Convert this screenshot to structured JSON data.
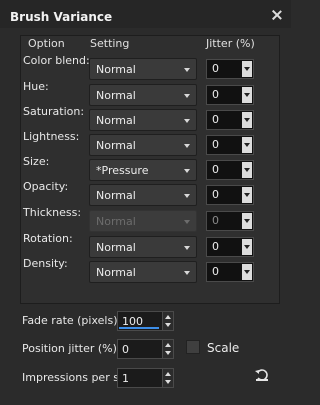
{
  "window": {
    "title": "Brush Variance"
  },
  "headers": {
    "option": "Option",
    "setting": "Setting",
    "jitter": "Jitter (%)"
  },
  "rows": [
    {
      "label": "Color blend:",
      "setting": "Normal",
      "jitter": "0"
    },
    {
      "label": "Hue:",
      "setting": "Normal",
      "jitter": "0"
    },
    {
      "label": "Saturation:",
      "setting": "Normal",
      "jitter": "0"
    },
    {
      "label": "Lightness:",
      "setting": "Normal",
      "jitter": "0"
    },
    {
      "label": "Size:",
      "setting": "*Pressure",
      "jitter": "0"
    },
    {
      "label": "Opacity:",
      "setting": "Normal",
      "jitter": "0"
    },
    {
      "label": "Thickness:",
      "setting": "Normal",
      "jitter": "0",
      "disabled": true
    },
    {
      "label": "Rotation:",
      "setting": "Normal",
      "jitter": "0"
    },
    {
      "label": "Density:",
      "setting": "Normal",
      "jitter": "0"
    }
  ],
  "footer": {
    "fade_rate": {
      "label": "Fade rate (pixels):",
      "value": "100"
    },
    "position_jitter": {
      "label": "Position jitter (%):",
      "value": "0"
    },
    "scale": {
      "label": "Scale"
    },
    "impressions": {
      "label": "Impressions per step:",
      "value": "1"
    }
  },
  "icons": {
    "close": "close-icon",
    "reset": "reset-icon"
  }
}
